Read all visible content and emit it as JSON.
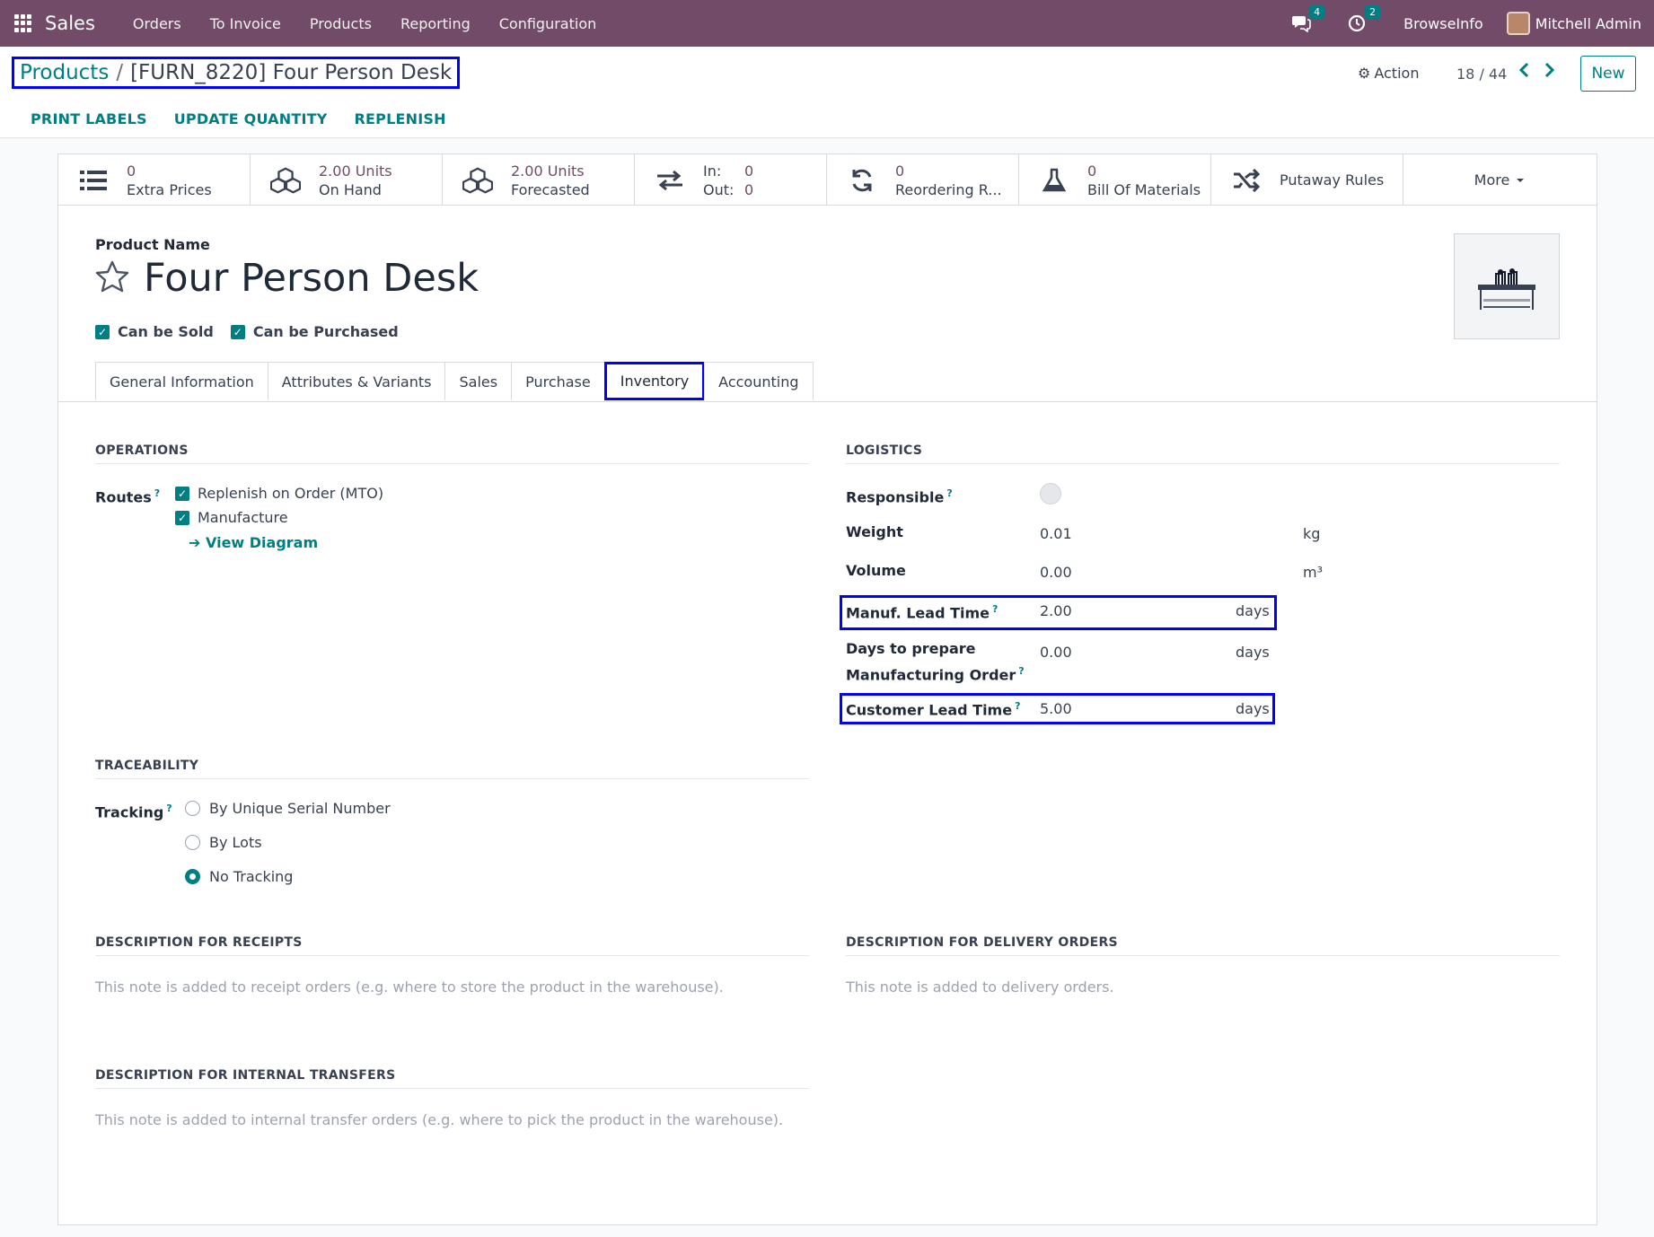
{
  "navbar": {
    "app_name": "Sales",
    "menu": [
      "Orders",
      "To Invoice",
      "Products",
      "Reporting",
      "Configuration"
    ],
    "messages_count": "4",
    "activities_count": "2",
    "company": "BrowseInfo",
    "user": "Mitchell Admin",
    "brand_color": "#714b67"
  },
  "breadcrumb": {
    "parent": "Products",
    "separator": "/",
    "current": "[FURN_8220] Four Person Desk"
  },
  "control": {
    "action_label": "Action",
    "pager": "18 / 44",
    "new_label": "New",
    "buttons": [
      "PRINT LABELS",
      "UPDATE QUANTITY",
      "REPLENISH"
    ]
  },
  "smart_buttons": [
    {
      "icon": "list-icon",
      "value": "0",
      "label": "Extra Prices"
    },
    {
      "icon": "cubes-icon",
      "value": "2.00 Units",
      "label": "On Hand"
    },
    {
      "icon": "cubes-icon",
      "value": "2.00 Units",
      "label": "Forecasted"
    },
    {
      "icon": "exchange-icon",
      "in_label": "In:",
      "in_value": "0",
      "out_label": "Out:",
      "out_value": "0"
    },
    {
      "icon": "refresh-icon",
      "value": "0",
      "label": "Reordering R..."
    },
    {
      "icon": "flask-icon",
      "value": "0",
      "label": "Bill Of Materials"
    },
    {
      "icon": "random-icon",
      "label": "Putaway Rules"
    },
    {
      "label": "More"
    }
  ],
  "product": {
    "name_label": "Product Name",
    "name": "Four Person Desk",
    "can_be_sold": "Can be Sold",
    "can_be_purchased": "Can be Purchased"
  },
  "tabs": [
    "General Information",
    "Attributes & Variants",
    "Sales",
    "Purchase",
    "Inventory",
    "Accounting"
  ],
  "active_tab": "Inventory",
  "operations": {
    "title": "OPERATIONS",
    "routes_label": "Routes",
    "help": "?",
    "routes": [
      "Replenish on Order (MTO)",
      "Manufacture"
    ],
    "view_diagram": "View Diagram"
  },
  "logistics": {
    "title": "LOGISTICS",
    "responsible_label": "Responsible",
    "weight_label": "Weight",
    "weight_value": "0.01",
    "weight_unit": "kg",
    "volume_label": "Volume",
    "volume_value": "0.00",
    "volume_unit": "m³",
    "manuf_lead_label": "Manuf. Lead Time",
    "manuf_lead_value": "2.00",
    "days_prepare_label_1": "Days to prepare",
    "days_prepare_label_2": "Manufacturing Order",
    "days_prepare_value": "0.00",
    "customer_lead_label": "Customer Lead Time",
    "customer_lead_value": "5.00",
    "days_unit": "days"
  },
  "traceability": {
    "title": "TRACEABILITY",
    "tracking_label": "Tracking",
    "options": [
      "By Unique Serial Number",
      "By Lots",
      "No Tracking"
    ],
    "selected": "No Tracking"
  },
  "descriptions": {
    "receipts_title": "DESCRIPTION FOR RECEIPTS",
    "receipts_placeholder": "This note is added to receipt orders (e.g. where to store the product in the warehouse).",
    "delivery_title": "DESCRIPTION FOR DELIVERY ORDERS",
    "delivery_placeholder": "This note is added to delivery orders.",
    "internal_title": "DESCRIPTION FOR INTERNAL TRANSFERS",
    "internal_placeholder": "This note is added to internal transfer orders (e.g. where to pick the product in the warehouse)."
  }
}
